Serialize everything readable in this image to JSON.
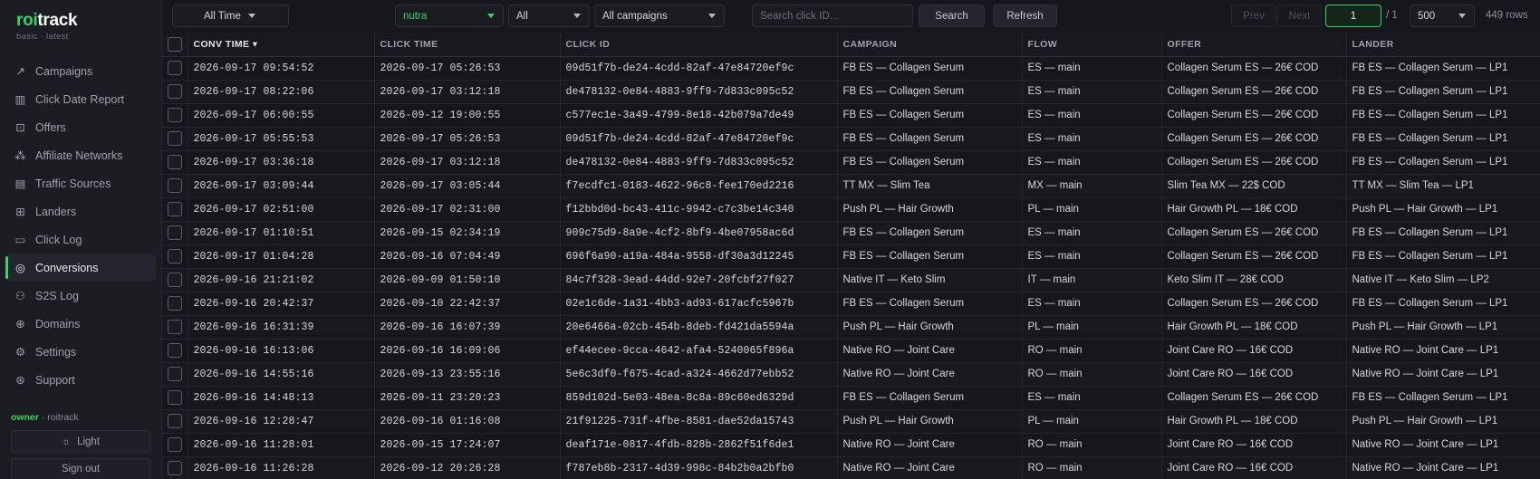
{
  "brand": {
    "name_prefix": "roi",
    "name_suffix": "track",
    "subtitle": "basic · latest"
  },
  "sidebar": {
    "items": [
      {
        "label": "Campaigns",
        "icon": "trend-icon",
        "glyph": "↗",
        "active": false
      },
      {
        "label": "Click Date Report",
        "icon": "bar-chart-icon",
        "glyph": "▥",
        "active": false
      },
      {
        "label": "Offers",
        "icon": "tag-icon",
        "glyph": "⊡",
        "active": false
      },
      {
        "label": "Affiliate Networks",
        "icon": "network-icon",
        "glyph": "⁂",
        "active": false
      },
      {
        "label": "Traffic Sources",
        "icon": "traffic-icon",
        "glyph": "▤",
        "active": false
      },
      {
        "label": "Landers",
        "icon": "grid-icon",
        "glyph": "⊞",
        "active": false
      },
      {
        "label": "Click Log",
        "icon": "clipboard-icon",
        "glyph": "▭",
        "active": false
      },
      {
        "label": "Conversions",
        "icon": "target-icon",
        "glyph": "◎",
        "active": true
      },
      {
        "label": "S2S Log",
        "icon": "users-icon",
        "glyph": "⚇",
        "active": false
      },
      {
        "label": "Domains",
        "icon": "globe-icon",
        "glyph": "⊕",
        "active": false
      },
      {
        "label": "Settings",
        "icon": "gear-icon",
        "glyph": "⚙",
        "active": false
      },
      {
        "label": "Support",
        "icon": "lifebuoy-icon",
        "glyph": "⊛",
        "active": false
      }
    ],
    "user_role": "owner",
    "user_org": " · roitrack",
    "theme_button": "Light",
    "signout_button": "Sign out"
  },
  "toolbar": {
    "date_range": "All Time",
    "vertical_filter": "nutra",
    "status_filter": "All",
    "campaign_filter": "All campaigns",
    "search_placeholder": "Search click ID...",
    "search_button": "Search",
    "refresh_button": "Refresh",
    "prev_button": "Prev",
    "next_button": "Next",
    "page_value": "1",
    "page_total": "/ 1",
    "per_page": "500",
    "row_count": "449 rows"
  },
  "colors": {
    "accent": "#3ecf6b",
    "background": "#15171c",
    "sidebar": "#1b1d23"
  },
  "table": {
    "columns": [
      "CONV TIME ▾",
      "CLICK TIME",
      "CLICK ID",
      "CAMPAIGN",
      "FLOW",
      "OFFER",
      "LANDER"
    ],
    "rows": [
      [
        "2026-09-17 09:54:52",
        "2026-09-17 05:26:53",
        "09d51f7b-de24-4cdd-82af-47e84720ef9c",
        "FB ES — Collagen Serum",
        "ES — main",
        "Collagen Serum ES — 26€ COD",
        "FB ES — Collagen Serum — LP1"
      ],
      [
        "2026-09-17 08:22:06",
        "2026-09-17 03:12:18",
        "de478132-0e84-4883-9ff9-7d833c095c52",
        "FB ES — Collagen Serum",
        "ES — main",
        "Collagen Serum ES — 26€ COD",
        "FB ES — Collagen Serum — LP1"
      ],
      [
        "2026-09-17 06:00:55",
        "2026-09-12 19:00:55",
        "c577ec1e-3a49-4799-8e18-42b079a7de49",
        "FB ES — Collagen Serum",
        "ES — main",
        "Collagen Serum ES — 26€ COD",
        "FB ES — Collagen Serum — LP1"
      ],
      [
        "2026-09-17 05:55:53",
        "2026-09-17 05:26:53",
        "09d51f7b-de24-4cdd-82af-47e84720ef9c",
        "FB ES — Collagen Serum",
        "ES — main",
        "Collagen Serum ES — 26€ COD",
        "FB ES — Collagen Serum — LP1"
      ],
      [
        "2026-09-17 03:36:18",
        "2026-09-17 03:12:18",
        "de478132-0e84-4883-9ff9-7d833c095c52",
        "FB ES — Collagen Serum",
        "ES — main",
        "Collagen Serum ES — 26€ COD",
        "FB ES — Collagen Serum — LP1"
      ],
      [
        "2026-09-17 03:09:44",
        "2026-09-17 03:05:44",
        "f7ecdfc1-0183-4622-96c8-fee170ed2216",
        "TT MX — Slim Tea",
        "MX — main",
        "Slim Tea MX — 22$ COD",
        "TT MX — Slim Tea — LP1"
      ],
      [
        "2026-09-17 02:51:00",
        "2026-09-17 02:31:00",
        "f12bbd0d-bc43-411c-9942-c7c3be14c340",
        "Push PL — Hair Growth",
        "PL — main",
        "Hair Growth PL — 18€ COD",
        "Push PL — Hair Growth — LP1"
      ],
      [
        "2026-09-17 01:10:51",
        "2026-09-15 02:34:19",
        "909c75d9-8a9e-4cf2-8bf9-4be07958ac6d",
        "FB ES — Collagen Serum",
        "ES — main",
        "Collagen Serum ES — 26€ COD",
        "FB ES — Collagen Serum — LP1"
      ],
      [
        "2026-09-17 01:04:28",
        "2026-09-16 07:04:49",
        "696f6a90-a19a-484a-9558-df30a3d12245",
        "FB ES — Collagen Serum",
        "ES — main",
        "Collagen Serum ES — 26€ COD",
        "FB ES — Collagen Serum — LP1"
      ],
      [
        "2026-09-16 21:21:02",
        "2026-09-09 01:50:10",
        "84c7f328-3ead-44dd-92e7-20fcbf27f027",
        "Native IT — Keto Slim",
        "IT — main",
        "Keto Slim IT — 28€ COD",
        "Native IT — Keto Slim — LP2"
      ],
      [
        "2026-09-16 20:42:37",
        "2026-09-10 22:42:37",
        "02e1c6de-1a31-4bb3-ad93-617acfc5967b",
        "FB ES — Collagen Serum",
        "ES — main",
        "Collagen Serum ES — 26€ COD",
        "FB ES — Collagen Serum — LP1"
      ],
      [
        "2026-09-16 16:31:39",
        "2026-09-16 16:07:39",
        "20e6466a-02cb-454b-8deb-fd421da5594a",
        "Push PL — Hair Growth",
        "PL — main",
        "Hair Growth PL — 18€ COD",
        "Push PL — Hair Growth — LP1"
      ],
      [
        "2026-09-16 16:13:06",
        "2026-09-16 16:09:06",
        "ef44ecee-9cca-4642-afa4-5240065f896a",
        "Native RO — Joint Care",
        "RO — main",
        "Joint Care RO — 16€ COD",
        "Native RO — Joint Care — LP1"
      ],
      [
        "2026-09-16 14:55:16",
        "2026-09-13 23:55:16",
        "5e6c3df0-f675-4cad-a324-4662d77ebb52",
        "Native RO — Joint Care",
        "RO — main",
        "Joint Care RO — 16€ COD",
        "Native RO — Joint Care — LP1"
      ],
      [
        "2026-09-16 14:48:13",
        "2026-09-11 23:20:23",
        "859d102d-5e03-48ea-8c8a-89c60ed6329d",
        "FB ES — Collagen Serum",
        "ES — main",
        "Collagen Serum ES — 26€ COD",
        "FB ES — Collagen Serum — LP1"
      ],
      [
        "2026-09-16 12:28:47",
        "2026-09-16 01:16:08",
        "21f91225-731f-4fbe-8581-dae52da15743",
        "Push PL — Hair Growth",
        "PL — main",
        "Hair Growth PL — 18€ COD",
        "Push PL — Hair Growth — LP1"
      ],
      [
        "2026-09-16 11:28:01",
        "2026-09-15 17:24:07",
        "deaf171e-0817-4fdb-828b-2862f51f6de1",
        "Native RO — Joint Care",
        "RO — main",
        "Joint Care RO — 16€ COD",
        "Native RO — Joint Care — LP1"
      ],
      [
        "2026-09-16 11:26:28",
        "2026-09-12 20:26:28",
        "f787eb8b-2317-4d39-998c-84b2b0a2bfb0",
        "Native RO — Joint Care",
        "RO — main",
        "Joint Care RO — 16€ COD",
        "Native RO — Joint Care — LP1"
      ]
    ]
  }
}
